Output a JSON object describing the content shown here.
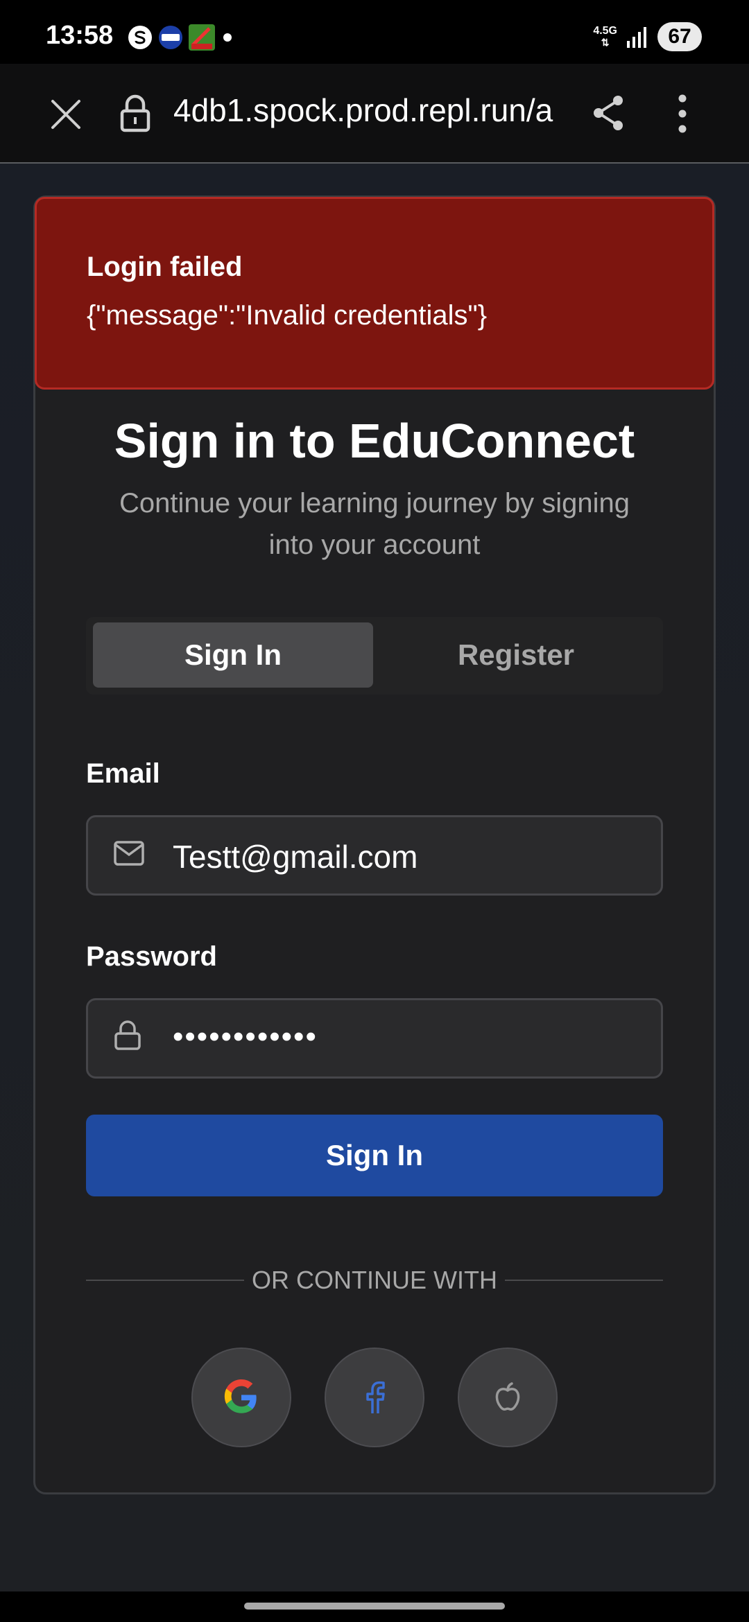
{
  "status_bar": {
    "time": "13:58",
    "network": "4.5G",
    "battery": "67"
  },
  "browser": {
    "url": "4db1.spock.prod.repl.run/a",
    "icons": [
      "close-icon",
      "lock-icon",
      "share-icon",
      "more-vertical-icon"
    ]
  },
  "alert": {
    "title": "Login failed",
    "message": "{\"message\":\"Invalid credentials\"}"
  },
  "auth": {
    "title": "Sign in to EduConnect",
    "subtitle": "Continue your learning journey by signing into your account",
    "tabs": [
      {
        "label": "Sign In",
        "active": true
      },
      {
        "label": "Register",
        "active": false
      }
    ],
    "email_label": "Email",
    "email_value": "Testt@gmail.com",
    "password_label": "Password",
    "password_value": "••••••••••••",
    "submit_label": "Sign In",
    "divider_text": "OR CONTINUE WITH",
    "social": [
      "google-icon",
      "facebook-icon",
      "apple-icon"
    ]
  },
  "colors": {
    "alert_bg": "#7d150f",
    "primary": "#1f4aa0"
  }
}
